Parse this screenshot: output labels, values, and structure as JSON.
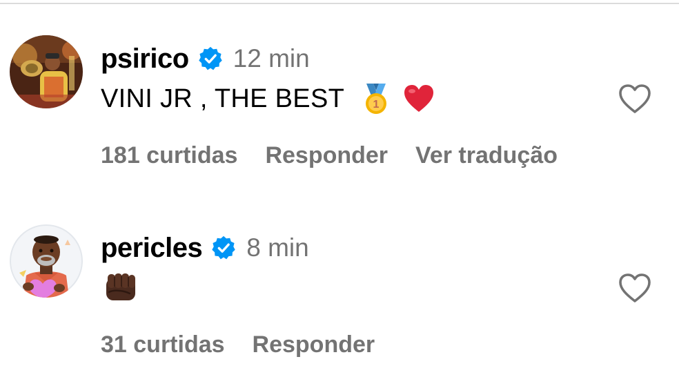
{
  "comments": [
    {
      "username": "psirico",
      "verified": true,
      "time": "12 min",
      "text": "VINI JR , THE BEST",
      "emojis": [
        "medal-emoji",
        "red-heart-emoji"
      ],
      "likes": "181 curtidas",
      "reply": "Responder",
      "translate": "Ver tradução"
    },
    {
      "username": "pericles",
      "verified": true,
      "time": "8 min",
      "text": "",
      "emojis": [
        "fist-emoji"
      ],
      "likes": "31 curtidas",
      "reply": "Responder"
    }
  ],
  "icons": {
    "verified": "verified-badge-icon",
    "like": "heart-outline-icon"
  },
  "colors": {
    "verified_blue": "#0095f6",
    "secondary_text": "#737373",
    "heart_red": "#e0243a",
    "divider": "#dbdbdb"
  }
}
